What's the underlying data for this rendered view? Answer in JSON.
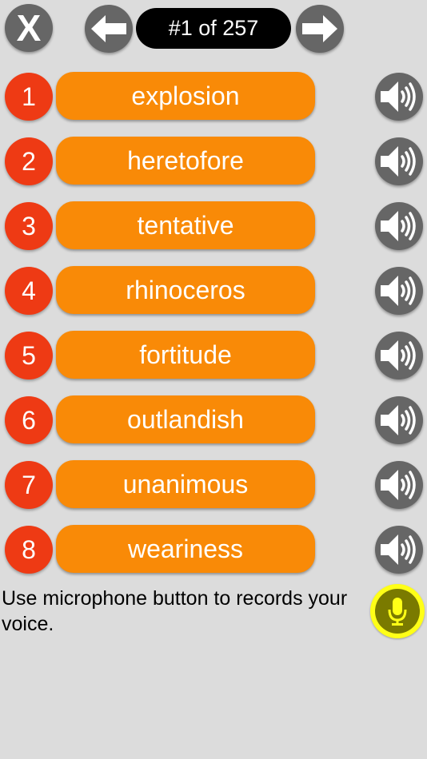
{
  "header": {
    "close_label": "X",
    "counter": "#1 of 257",
    "prev_icon": "arrow-left-icon",
    "next_icon": "arrow-right-icon"
  },
  "words": [
    {
      "number": "1",
      "word": "explosion"
    },
    {
      "number": "2",
      "word": "heretofore"
    },
    {
      "number": "3",
      "word": "tentative"
    },
    {
      "number": "4",
      "word": "rhinoceros"
    },
    {
      "number": "5",
      "word": "fortitude"
    },
    {
      "number": "6",
      "word": "outlandish"
    },
    {
      "number": "7",
      "word": "unanimous"
    },
    {
      "number": "8",
      "word": "weariness"
    }
  ],
  "footer": {
    "hint": "Use microphone button to records your voice.",
    "mic_icon": "microphone-icon"
  },
  "colors": {
    "background": "#dcdcdc",
    "number_badge": "#ee3a14",
    "word_button": "#f98a07",
    "icon_button": "#666666",
    "mic_button": "#ffff17"
  }
}
